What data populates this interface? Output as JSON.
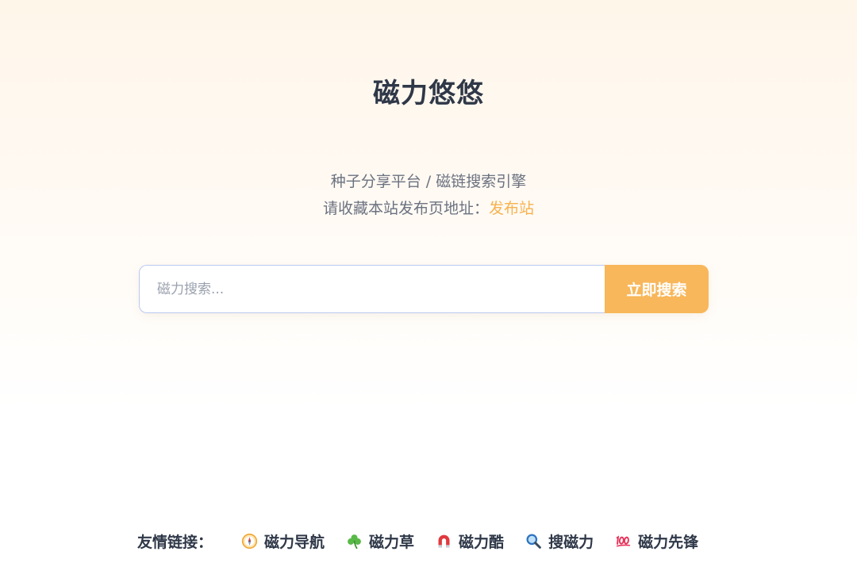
{
  "site": {
    "title": "磁力悠悠",
    "tagline": "种子分享平台 / 磁链搜索引擎",
    "notice_prefix": "请收藏本站发布页地址：",
    "notice_link": "发布站"
  },
  "search": {
    "placeholder": "磁力搜索...",
    "button_label": "立即搜索"
  },
  "friend_links": {
    "label": "友情链接：",
    "items": [
      {
        "icon": "compass-icon",
        "label": "磁力导航"
      },
      {
        "icon": "shamrock-icon",
        "label": "磁力草"
      },
      {
        "icon": "magnet-icon",
        "label": "磁力酷"
      },
      {
        "icon": "magnifier-icon",
        "label": "搜磁力"
      },
      {
        "icon": "hundred-points-icon",
        "label": "磁力先锋"
      }
    ]
  },
  "colors": {
    "accent": "#f8b75a",
    "link": "#f7b24e",
    "title": "#2f3848",
    "muted": "#6b7280"
  }
}
